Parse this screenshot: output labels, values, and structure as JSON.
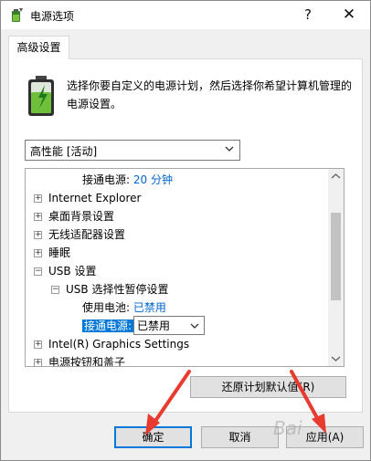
{
  "window": {
    "title": "电源选项",
    "help_glyph": "?",
    "close_glyph": "✕"
  },
  "tab": {
    "label": "高级设置"
  },
  "description": "选择你要自定义的电源计划，然后选择你希望计算机管理的电源设置。",
  "plan_select": {
    "value": "高性能 [活动]"
  },
  "tree": {
    "row_plugged_top": {
      "label": "接通电源:",
      "value": "20 分钟"
    },
    "items": [
      {
        "label": "Internet Explorer"
      },
      {
        "label": "桌面背景设置"
      },
      {
        "label": "无线适配器设置"
      },
      {
        "label": "睡眠"
      }
    ],
    "usb": {
      "label": "USB 设置",
      "child": {
        "label": "USB 选择性暂停设置",
        "battery": {
          "label": "使用电池:",
          "value": "已禁用"
        },
        "plugged": {
          "label": "接通电源:",
          "value": "已禁用"
        }
      }
    },
    "intel": {
      "label": "Intel(R) Graphics Settings"
    },
    "power_buttons": {
      "label": "电源按钮和盖子"
    },
    "expander_plus": "+",
    "expander_minus": "−"
  },
  "buttons": {
    "restore": "还原计划默认值(R)",
    "ok": "确定",
    "cancel": "取消",
    "apply": "应用(A)"
  },
  "watermark": "Bai",
  "colors": {
    "accent": "#0078d7",
    "link": "#0066cc",
    "annotation_arrow": "#e83a2f"
  }
}
